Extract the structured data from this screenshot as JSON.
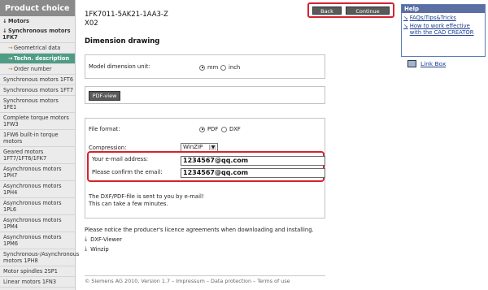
{
  "sidebar": {
    "title": "Product choice",
    "items": [
      {
        "label": "Motors",
        "arrow": "↓"
      },
      {
        "label": "Synchronous motors 1FK7",
        "arrow": "↓"
      },
      {
        "label": "Geometrical data",
        "arrow": "→"
      },
      {
        "label": "Techn. description",
        "arrow": "→"
      },
      {
        "label": "Order number",
        "arrow": "→"
      },
      {
        "label": "Synchronous motors 1FT6"
      },
      {
        "label": "Synchronous motors 1FT7"
      },
      {
        "label": "Synchronous motors 1FE1"
      },
      {
        "label": "Complete torque motors 1FW3"
      },
      {
        "label": "1FW6 built-in torque motors"
      },
      {
        "label": "Geared motors 1FT7/1FT6/1FK7"
      },
      {
        "label": "Asynchronous motors 1PH7"
      },
      {
        "label": "Asynchronous motors 1PH4"
      },
      {
        "label": "Asynchronous motors 1PL6"
      },
      {
        "label": "Asynchronous motors 1PM4"
      },
      {
        "label": "Asynchronous motors 1PM6"
      },
      {
        "label": "Synchronous-/Asynchronous motors 1PH8"
      },
      {
        "label": "Motor spindles 2SP1"
      },
      {
        "label": "Linear motors 1FN3"
      }
    ]
  },
  "header": {
    "product_code_line1": "1FK7011-5AK21-1AA3-Z",
    "product_code_line2": "X02",
    "section_title": "Dimension drawing",
    "back_label": "Back",
    "continue_label": "Continue"
  },
  "unit": {
    "label": "Model dimension unit:",
    "options": [
      "mm",
      "inch"
    ],
    "selected": "mm"
  },
  "pdf_view": {
    "label": "PDF-view"
  },
  "form": {
    "file_format_label": "File format:",
    "formats": [
      "PDF",
      "DXF"
    ],
    "selected_format": "PDF",
    "compression_label": "Compression:",
    "compression_value": "WinZIP",
    "email_label": "Your e-mail address:",
    "email_value": "1234567@qq.com",
    "confirm_label": "Please confirm the email:",
    "confirm_value": "1234567@qq.com",
    "note_line1": "The DXF/PDF-file is sent to you by e-mail!",
    "note_line2": "This can take a few minutes."
  },
  "licence": {
    "text": "Please notice the producer's licence agreements when downloading and installing.",
    "links": [
      "DXF-Viewer",
      "Winzip"
    ]
  },
  "footer": {
    "text": "© Siemens AG 2010, Version 1.7 – Impressum – Data protection – Terms of use"
  },
  "help": {
    "title": "Help",
    "links": [
      "FAQs/Tips&Tricks",
      "How to work effective with the CAD CREATOR"
    ],
    "linkbox": "Link Box"
  },
  "colors": {
    "highlight": "#d6222f",
    "active_nav": "#4f9c84",
    "help_header": "#5c6fa3"
  }
}
